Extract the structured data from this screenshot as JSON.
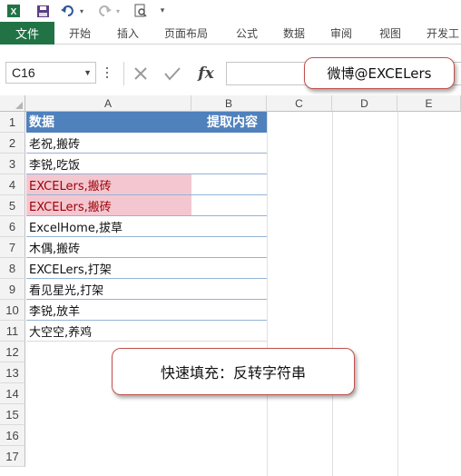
{
  "qat": {
    "icons": [
      "excel-app-icon",
      "save-icon",
      "undo-icon",
      "redo-icon",
      "print-preview-icon",
      "customize-qat-icon"
    ]
  },
  "ribbon": {
    "file_tab": "文件",
    "tabs": [
      "开始",
      "插入",
      "页面布局",
      "公式",
      "数据",
      "审阅",
      "视图",
      "开发工"
    ]
  },
  "formula_bar": {
    "name_box": "C16",
    "formula": ""
  },
  "callouts": {
    "top": "微博@EXCELers",
    "middle": "快速填充：反转字符串"
  },
  "sheet": {
    "columns": [
      "A",
      "B",
      "C",
      "D",
      "E"
    ],
    "row_numbers": [
      "1",
      "2",
      "3",
      "4",
      "5",
      "6",
      "7",
      "8",
      "9",
      "10",
      "11",
      "12",
      "13",
      "14",
      "15",
      "16",
      "17"
    ],
    "header": {
      "a": "数据",
      "b": "提取内容"
    },
    "rows": [
      {
        "a": "老祝,搬砖",
        "b": ""
      },
      {
        "a": "李锐,吃饭",
        "b": ""
      },
      {
        "a": "EXCELers,搬砖",
        "b": ""
      },
      {
        "a": "EXCELers,搬砖",
        "b": ""
      },
      {
        "a": "ExcelHome,拔草",
        "b": ""
      },
      {
        "a": "木偶,搬砖",
        "b": ""
      },
      {
        "a": "EXCELers,打架",
        "b": ""
      },
      {
        "a": "看见星光,打架",
        "b": ""
      },
      {
        "a": "李锐,放羊",
        "b": ""
      },
      {
        "a": "大空空,养鸡",
        "b": ""
      }
    ]
  },
  "colors": {
    "excel_green": "#217346",
    "table_header": "#4f81bd",
    "duplicate_fill": "#f4c7d0",
    "duplicate_text": "#9c0006",
    "callout_border": "#c0504d"
  }
}
